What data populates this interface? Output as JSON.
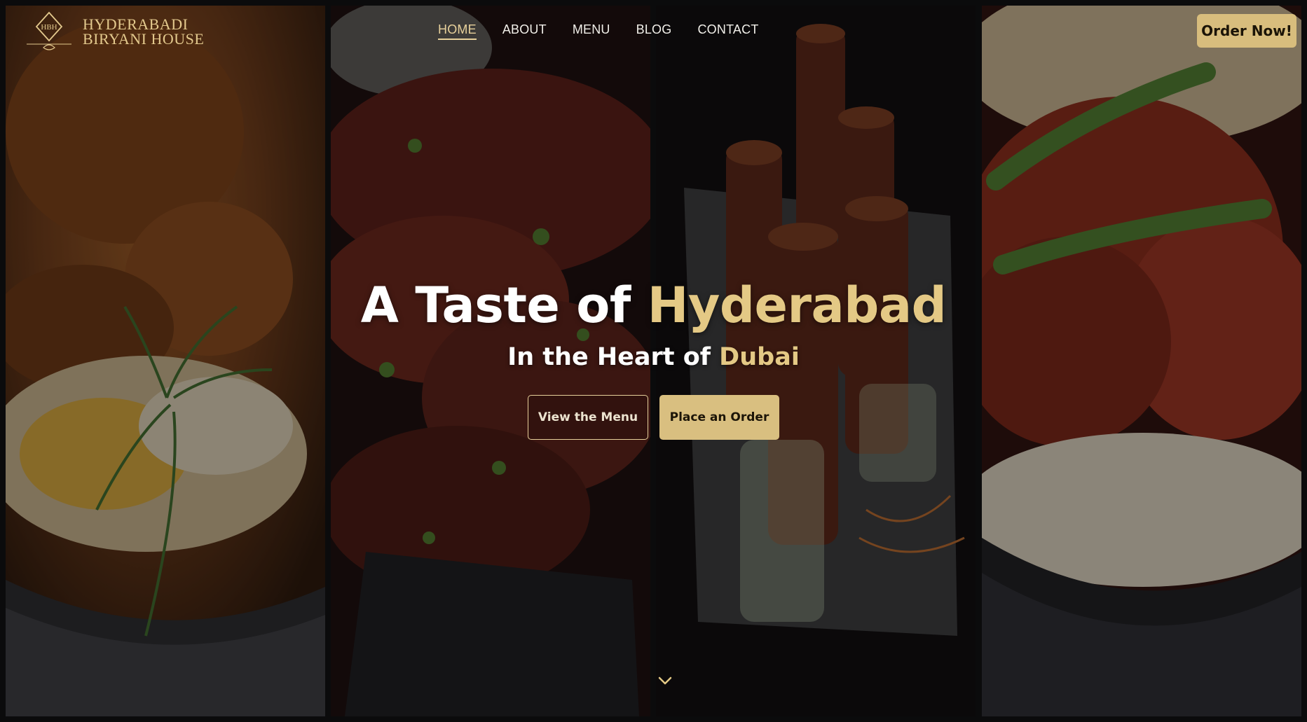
{
  "brand": {
    "monogram": "HBH",
    "line1": "HYDERABADI",
    "line2": "BIRYANI HOUSE",
    "gold": "#e4c985"
  },
  "nav": {
    "items": [
      {
        "label": "HOME",
        "active": true
      },
      {
        "label": "ABOUT",
        "active": false
      },
      {
        "label": "MENU",
        "active": false
      },
      {
        "label": "BLOG",
        "active": false
      },
      {
        "label": "CONTACT",
        "active": false
      }
    ]
  },
  "header": {
    "order_button": "Order Now!"
  },
  "hero": {
    "headline_prefix": "A Taste of ",
    "headline_highlight": "Hyderabad",
    "subheadline_prefix": "In the Heart of ",
    "subheadline_highlight": "Dubai",
    "primary_button": "View the Menu",
    "secondary_button": "Place an Order",
    "scroll_icon": "chevron-down-icon"
  },
  "panels": [
    {
      "icon": "biryani-photo"
    },
    {
      "icon": "chilli-chicken-photo"
    },
    {
      "icon": "kebab-rolls-photo"
    },
    {
      "icon": "chicken-biryani-photo"
    }
  ]
}
